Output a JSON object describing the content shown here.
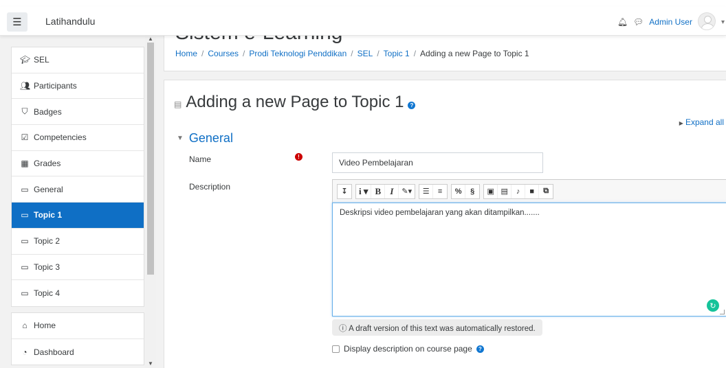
{
  "navbar": {
    "menu_icon": "hamburger-icon",
    "site_name": "Latihandulu",
    "notification_icon": "bell-icon",
    "message_icon": "chat-icon",
    "user_name": "Admin User"
  },
  "sidebar": {
    "course_items": [
      {
        "icon": "graduation-cap-icon",
        "label": "SEL"
      },
      {
        "icon": "users-icon",
        "label": "Participants"
      },
      {
        "icon": "shield-icon",
        "label": "Badges"
      },
      {
        "icon": "checkbox-icon",
        "label": "Competencies"
      },
      {
        "icon": "table-icon",
        "label": "Grades"
      },
      {
        "icon": "folder-icon",
        "label": "General"
      },
      {
        "icon": "folder-icon",
        "label": "Topic 1",
        "active": true
      },
      {
        "icon": "folder-icon",
        "label": "Topic 2"
      },
      {
        "icon": "folder-icon",
        "label": "Topic 3"
      },
      {
        "icon": "folder-icon",
        "label": "Topic 4"
      }
    ],
    "site_items": [
      {
        "icon": "home-icon",
        "label": "Home"
      },
      {
        "icon": "dashboard-icon",
        "label": "Dashboard"
      }
    ],
    "accent_color": "#0f6fc5"
  },
  "header": {
    "site_heading": "Sistem e-Learning",
    "breadcrumb": [
      "Home",
      "Courses",
      "Prodi Teknologi Penddikan",
      "SEL",
      "Topic 1",
      "Adding a new Page to Topic 1"
    ]
  },
  "form": {
    "page_heading": "Adding a new Page to Topic 1",
    "expand_all": "Expand all",
    "section_title": "General",
    "name_label": "Name",
    "name_value": "Video Pembelajaran",
    "description_label": "Description",
    "description_text": "Deskripsi video pembelajaran yang akan ditampilkan.......",
    "draft_note": "A draft version of this text was automatically restored.",
    "display_description_label": "Display description on course page"
  },
  "toolbar": {
    "groups": [
      [
        "↥"
      ],
      [
        "i ▾",
        "B",
        "I",
        "✍ ▾"
      ],
      [
        "☰",
        "☷"
      ],
      [
        "🔗",
        "⛓"
      ],
      [
        "▣",
        "▤",
        "🎙",
        "■",
        "⧉"
      ]
    ]
  }
}
